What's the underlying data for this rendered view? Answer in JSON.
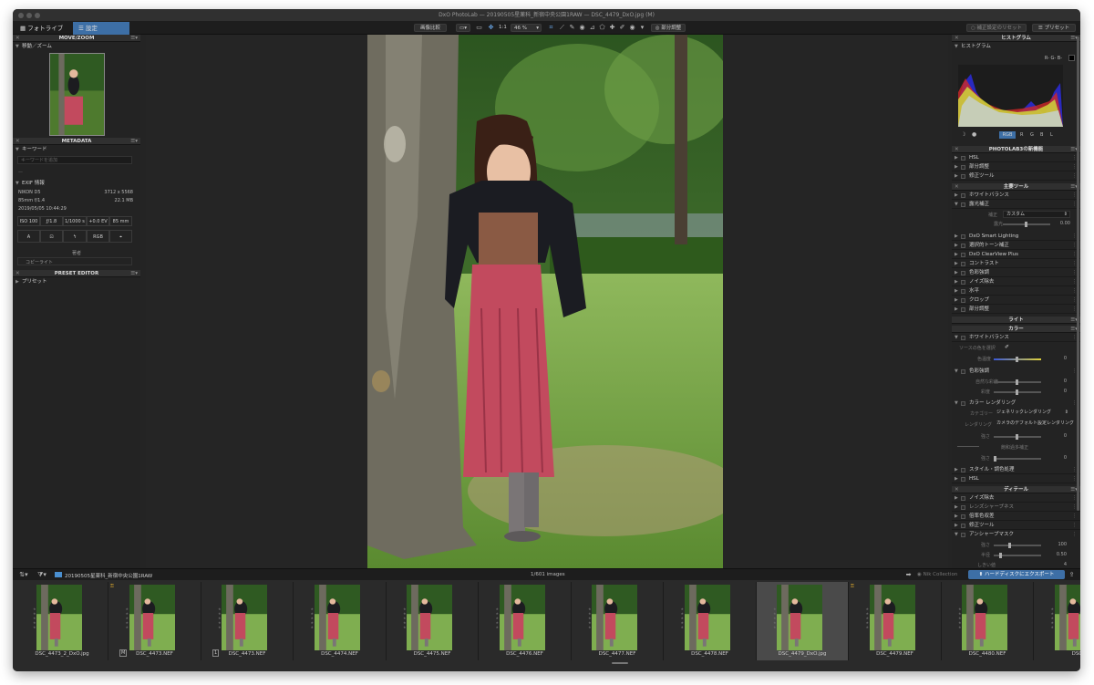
{
  "window": {
    "title": "DxO PhotoLab — 20190505星薬科_新宿中央公園1RAW — DSC_4479_DxO.jpg (M)"
  },
  "toolbar": {
    "tab_library": "フォトライブラリ",
    "tab_customize": "設定",
    "compare": "画像比較",
    "zoom_one": "1:1",
    "zoom_pct": "46 %",
    "local_adjust": "部分調整",
    "reset": "補正設定のリセット",
    "preset": "プリセット"
  },
  "left": {
    "move_zoom": {
      "header": "MOVE/ZOOM",
      "sub": "移動／ズーム"
    },
    "metadata": {
      "header": "METADATA",
      "keywords_label": "キーワード",
      "keywords_placeholder": "キーワードを追加",
      "dash": "—",
      "exif_label": "EXIF 情報",
      "camera": "NIKON D5",
      "dims": "3712 x 5568",
      "lens": "85mm f/1.4",
      "size": "22.1 MB",
      "date": "2019/05/05 10:44:29",
      "iso": "ISO 100",
      "aperture": "ƒ/1.8",
      "shutter": "1/1000 s",
      "ev": "+0.0 EV",
      "focal": "85 mm",
      "mode": "A",
      "rgb": "RGB",
      "author_label": "著者",
      "copyright_label": "コピーライト"
    },
    "preset_editor": {
      "header": "PRESET EDITOR",
      "item": "プリセット"
    }
  },
  "right": {
    "histogram": {
      "header": "ヒストグラム",
      "sub": "ヒストグラム",
      "readout": "R- G- B-",
      "tabs": [
        "RGB",
        "R",
        "G",
        "B",
        "L"
      ]
    },
    "new_features": {
      "header": "PHOTOLAB3の新機能",
      "items": [
        "HSL",
        "部分調整",
        "修正ツール"
      ]
    },
    "essential": {
      "header": "主要ツール",
      "items": [
        "ホワイトバランス",
        "露光補正"
      ],
      "exposure_mode_label": "補正",
      "exposure_mode": "カスタム",
      "exposure_label": "露光",
      "exposure_value": "0.00",
      "items2": [
        "DxO Smart Lighting",
        "選択的トーン補正",
        "DxO ClearView Plus",
        "コントラスト",
        "色彩強調",
        "ノイズ除去",
        "水平",
        "クロップ",
        "部分調整"
      ]
    },
    "light": {
      "header": "ライト"
    },
    "color": {
      "header": "カラー",
      "wb": "ホワイトバランス",
      "wb_pick": "ソースの色を選択",
      "temp_label": "色温度",
      "temp_value": "0",
      "vibrance": "色彩強調",
      "vib1_label": "自然な彩度",
      "vib1_value": "0",
      "vib2_label": "彩度",
      "vib2_value": "0",
      "render": "カラー レンダリング",
      "cat_label": "カテゴリー",
      "cat_value": "ジェネリックレンダリング",
      "render_label": "レンダリング",
      "render_value": "カメラのデフォルト設定レンダリング",
      "intensity_label": "強さ",
      "intensity_value": "0",
      "protect_label": "飽和過多補正",
      "prot_label": "強さ",
      "prot_value": "0",
      "style": "スタイル・調色処理",
      "hsl": "HSL"
    },
    "detail": {
      "header": "ディテール",
      "items": [
        "ノイズ除去",
        "レンズシャープネス",
        "倍率色収差",
        "修正ツール",
        "アンシャープマスク"
      ],
      "usm1_label": "強さ",
      "usm1_value": "100",
      "usm2_label": "半径",
      "usm2_value": "0.50",
      "usm3_label": "しきい値",
      "usm3_value": "4"
    }
  },
  "filmstrip": {
    "folder": "20190505星薬科_新宿中央公園1RAW",
    "count": "1/601 images",
    "nik": "Nik Collection",
    "export": "ハードディスクにエクスポート",
    "badge_m": "M",
    "badge_1": "1",
    "thumbs": [
      "DSC_4473_2_DxO.jpg",
      "DSC_4473.NEF",
      "DSC_4473.NEF",
      "DSC_4474.NEF",
      "DSC_4475.NEF",
      "DSC_4476.NEF",
      "DSC_4477.NEF",
      "DSC_4478.NEF",
      "DSC_4479_DxO.jpg",
      "DSC_4479.NEF",
      "DSC_4480.NEF",
      "DSC_4"
    ]
  },
  "colors": {
    "accent": "#3d6fa6",
    "panel": "#232323",
    "background": "#242424"
  }
}
